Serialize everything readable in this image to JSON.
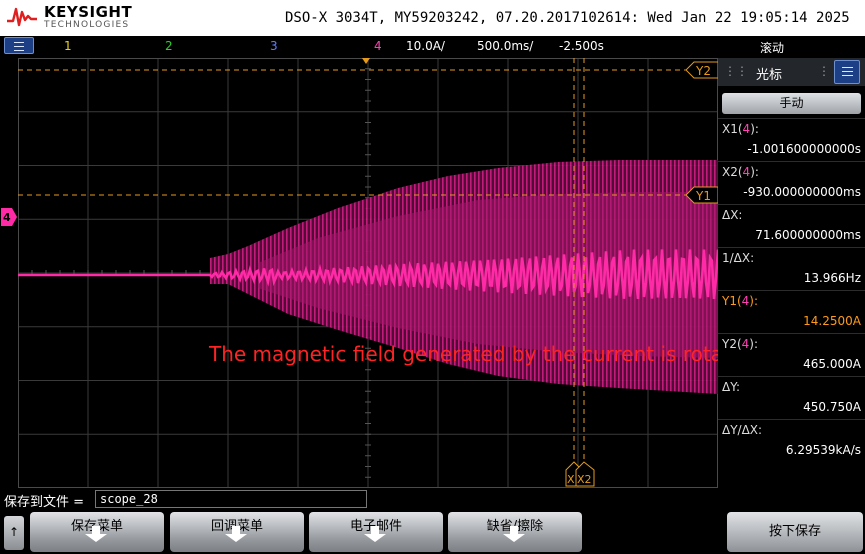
{
  "header": {
    "brand": "KEYSIGHT",
    "brand_sub": "TECHNOLOGIES",
    "info": "DSO-X 3034T, MY59203242, 07.20.2017102614: Wed Jan 22 19:05:14 2025"
  },
  "channel_bar": {
    "ch1": "1",
    "ch2": "2",
    "ch3": "3",
    "ch4": "4",
    "scale": "10.0A/",
    "timebase": "500.0ms/",
    "delay": "-2.500s",
    "mode": "滚动"
  },
  "waveform": {
    "channel_marker": "4",
    "cursor_labels": {
      "y1": "Y1",
      "y2": "Y2",
      "x1": "X1",
      "x2": "X2"
    }
  },
  "annotation": "The magnetic field generated by the current is rotating",
  "panel": {
    "title": "光标",
    "manual_button": "手动",
    "readouts": [
      {
        "label": "X1(4):",
        "value": "-1.001600000000s"
      },
      {
        "label": "X2(4):",
        "value": "-930.000000000ms"
      },
      {
        "label": "ΔX:",
        "value": "71.600000000ms"
      },
      {
        "label": "1/ΔX:",
        "value": "13.966Hz"
      },
      {
        "label": "Y1(4):",
        "value": "14.2500A"
      },
      {
        "label": "Y2(4):",
        "value": "465.000A"
      },
      {
        "label": "ΔY:",
        "value": "450.750A"
      },
      {
        "label": "ΔY/ΔX:",
        "value": "6.29539kA/s"
      }
    ]
  },
  "save_bar": {
    "label": "保存到文件 =",
    "filename": "scope_28"
  },
  "softkeys": {
    "arrow": "↑",
    "keys": [
      "保存菜单",
      "回调菜单",
      "电子邮件",
      "缺省/擦除"
    ],
    "press_save": "按下保存"
  },
  "colors": {
    "trace": "#e0208f",
    "cursor": "#e59a1e",
    "ch1": "#e8d21c",
    "ch2": "#2ed02e",
    "ch3": "#5e7cff",
    "ch4": "#ff42b4",
    "annotation": "#ff2323"
  }
}
